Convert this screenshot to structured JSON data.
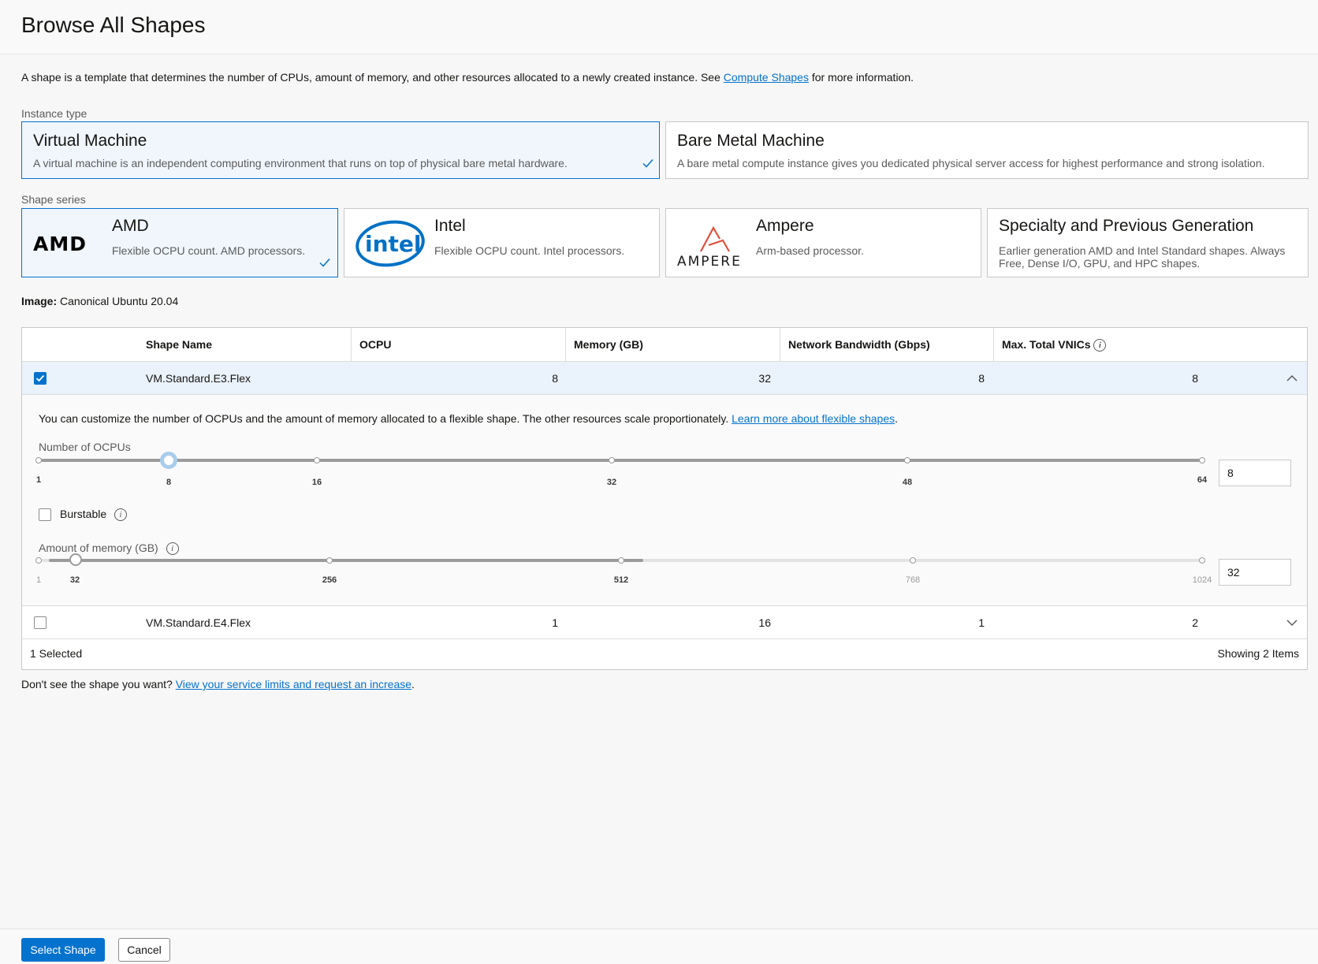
{
  "header": {
    "title": "Browse All Shapes"
  },
  "intro": {
    "text_before": "A shape is a template that determines the number of CPUs, amount of memory, and other resources allocated to a newly created instance. See ",
    "link": "Compute Shapes",
    "text_after": " for more information."
  },
  "instance_type": {
    "label": "Instance type",
    "options": [
      {
        "title": "Virtual Machine",
        "desc": "A virtual machine is an independent computing environment that runs on top of physical bare metal hardware."
      },
      {
        "title": "Bare Metal Machine",
        "desc": "A bare metal compute instance gives you dedicated physical server access for highest performance and strong isolation."
      }
    ]
  },
  "shape_series": {
    "label": "Shape series",
    "options": [
      {
        "title": "AMD",
        "desc": "Flexible OCPU count. AMD processors.",
        "logo": "AMD"
      },
      {
        "title": "Intel",
        "desc": "Flexible OCPU count. Intel processors.",
        "logo": "intel"
      },
      {
        "title": "Ampere",
        "desc": "Arm-based processor.",
        "logo": "AMPERE"
      },
      {
        "title": "Specialty and Previous Generation",
        "desc": "Earlier generation AMD and Intel Standard shapes. Always Free, Dense I/O, GPU, and HPC shapes."
      }
    ]
  },
  "image": {
    "label": "Image:",
    "value": "Canonical Ubuntu 20.04"
  },
  "table": {
    "headers": [
      "Shape Name",
      "OCPU",
      "Memory (GB)",
      "Network Bandwidth (Gbps)",
      "Max. Total VNICs"
    ],
    "rows": [
      {
        "name": "VM.Standard.E3.Flex",
        "ocpu": "8",
        "memory": "32",
        "bandwidth": "8",
        "vnics": "8"
      },
      {
        "name": "VM.Standard.E4.Flex",
        "ocpu": "1",
        "memory": "16",
        "bandwidth": "1",
        "vnics": "2"
      }
    ],
    "expanded": {
      "text_before": "You can customize the number of OCPUs and the amount of memory allocated to a flexible shape. The other resources scale proportionately. ",
      "link": "Learn more about flexible shapes",
      "text_after": ".",
      "ocpu_label": "Number of OCPUs",
      "ocpu_ticks": [
        "1",
        "8",
        "16",
        "32",
        "48",
        "64"
      ],
      "ocpu_value": "8",
      "burstable_label": "Burstable",
      "memory_label": "Amount of memory (GB)",
      "memory_ticks": [
        "1",
        "32",
        "256",
        "512",
        "768",
        "1024"
      ],
      "memory_value": "32"
    },
    "footer": {
      "selected": "1 Selected",
      "showing": "Showing 2 Items"
    }
  },
  "hint": {
    "text_before": "Don't see the shape you want? ",
    "link": "View your service limits and request an increase",
    "text_after": "."
  },
  "buttons": {
    "primary": "Select Shape",
    "secondary": "Cancel"
  },
  "colors": {
    "accent": "#0572ce",
    "selected_bg": "#f0f6fc"
  }
}
